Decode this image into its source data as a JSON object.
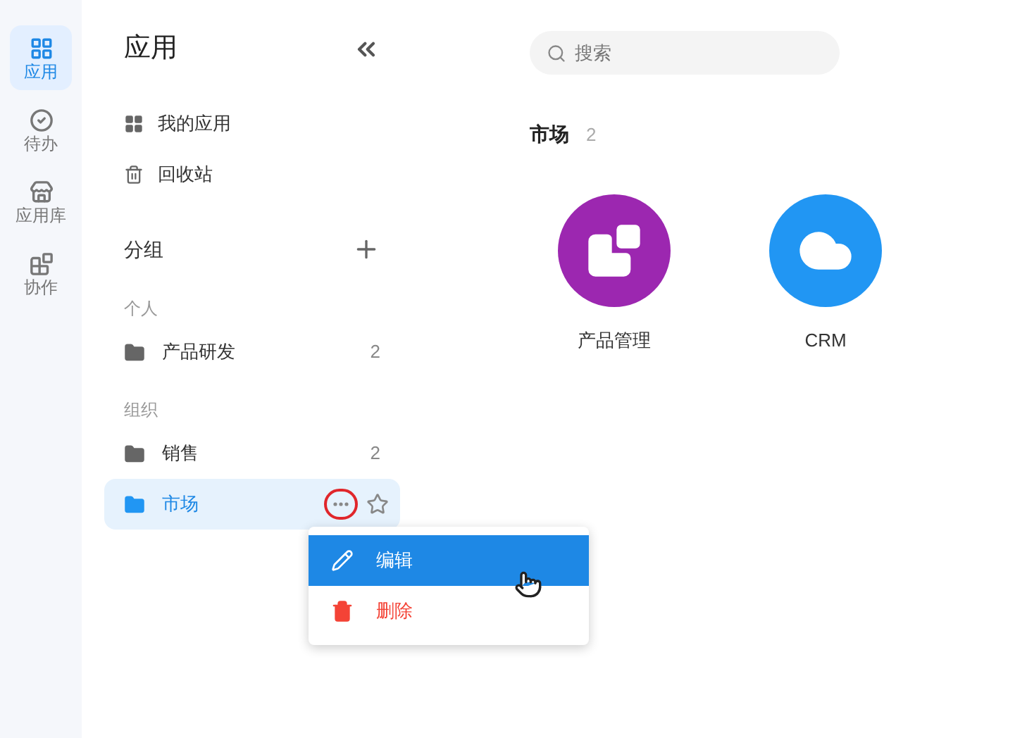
{
  "rail": {
    "items": [
      {
        "label": "应用",
        "selected": true
      },
      {
        "label": "待办",
        "selected": false
      },
      {
        "label": "应用库",
        "selected": false
      },
      {
        "label": "协作",
        "selected": false
      }
    ]
  },
  "sidebar": {
    "title": "应用",
    "nav": [
      "我的应用",
      "回收站"
    ],
    "groups_title": "分组",
    "sections": [
      {
        "heading": "个人",
        "folders": [
          {
            "name": "产品研发",
            "count": "2",
            "selected": false
          }
        ]
      },
      {
        "heading": "组织",
        "folders": [
          {
            "name": "销售",
            "count": "2",
            "selected": false
          },
          {
            "name": "市场",
            "selected": true
          }
        ]
      }
    ]
  },
  "context_menu": {
    "items": [
      {
        "kind": "edit",
        "label": "编辑",
        "highlighted": true
      },
      {
        "kind": "delete",
        "label": "删除",
        "highlighted": false
      }
    ]
  },
  "main": {
    "search": {
      "placeholder": "搜索"
    },
    "heading": "市场",
    "count": "2",
    "apps": [
      {
        "name": "产品管理",
        "color": "#9c27b0"
      },
      {
        "name": "CRM",
        "color": "#2196f3"
      }
    ]
  }
}
